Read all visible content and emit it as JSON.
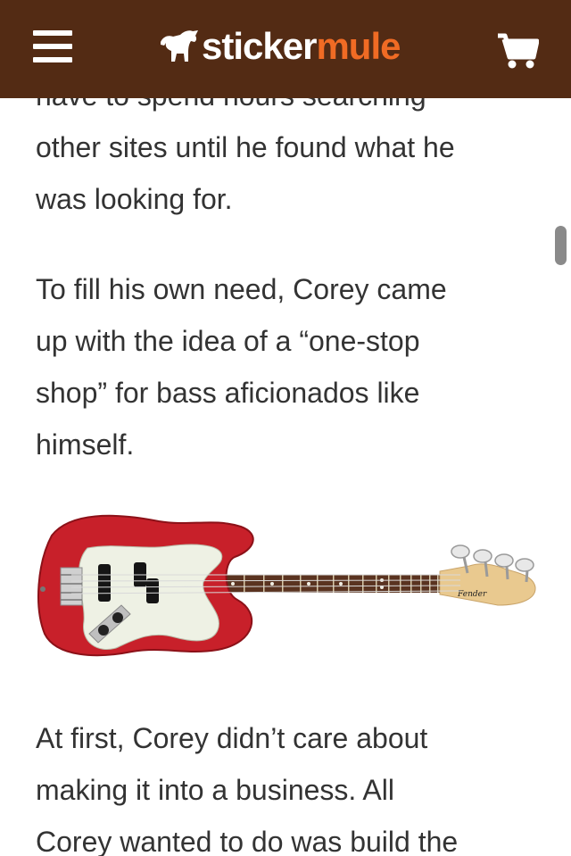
{
  "header": {
    "menu_icon": "hamburger-menu-icon",
    "logo_part1": "sticker",
    "logo_part2": "mule",
    "logo_icon": "mule-icon",
    "cart_icon": "shopping-cart-icon",
    "background_color": "#532b14",
    "accent_color": "#f06b24"
  },
  "article": {
    "paragraphs": [
      {
        "lines": [
          "have to spend hours searching",
          "other sites until he found what he",
          "was looking for."
        ]
      },
      {
        "lines": [
          "To fill his own need, Corey came",
          "up with the idea of a “one-stop",
          "shop” for bass aficionados like",
          "himself."
        ]
      },
      {
        "lines": [
          "At first, Corey didn’t care about",
          "making it into a business. All",
          "Corey wanted to do was build the"
        ]
      }
    ],
    "image": {
      "subject": "red bass guitar",
      "body_color": "#c8202a",
      "pickguard_color": "#eef1e4",
      "headstock_brand": "Fender"
    }
  }
}
